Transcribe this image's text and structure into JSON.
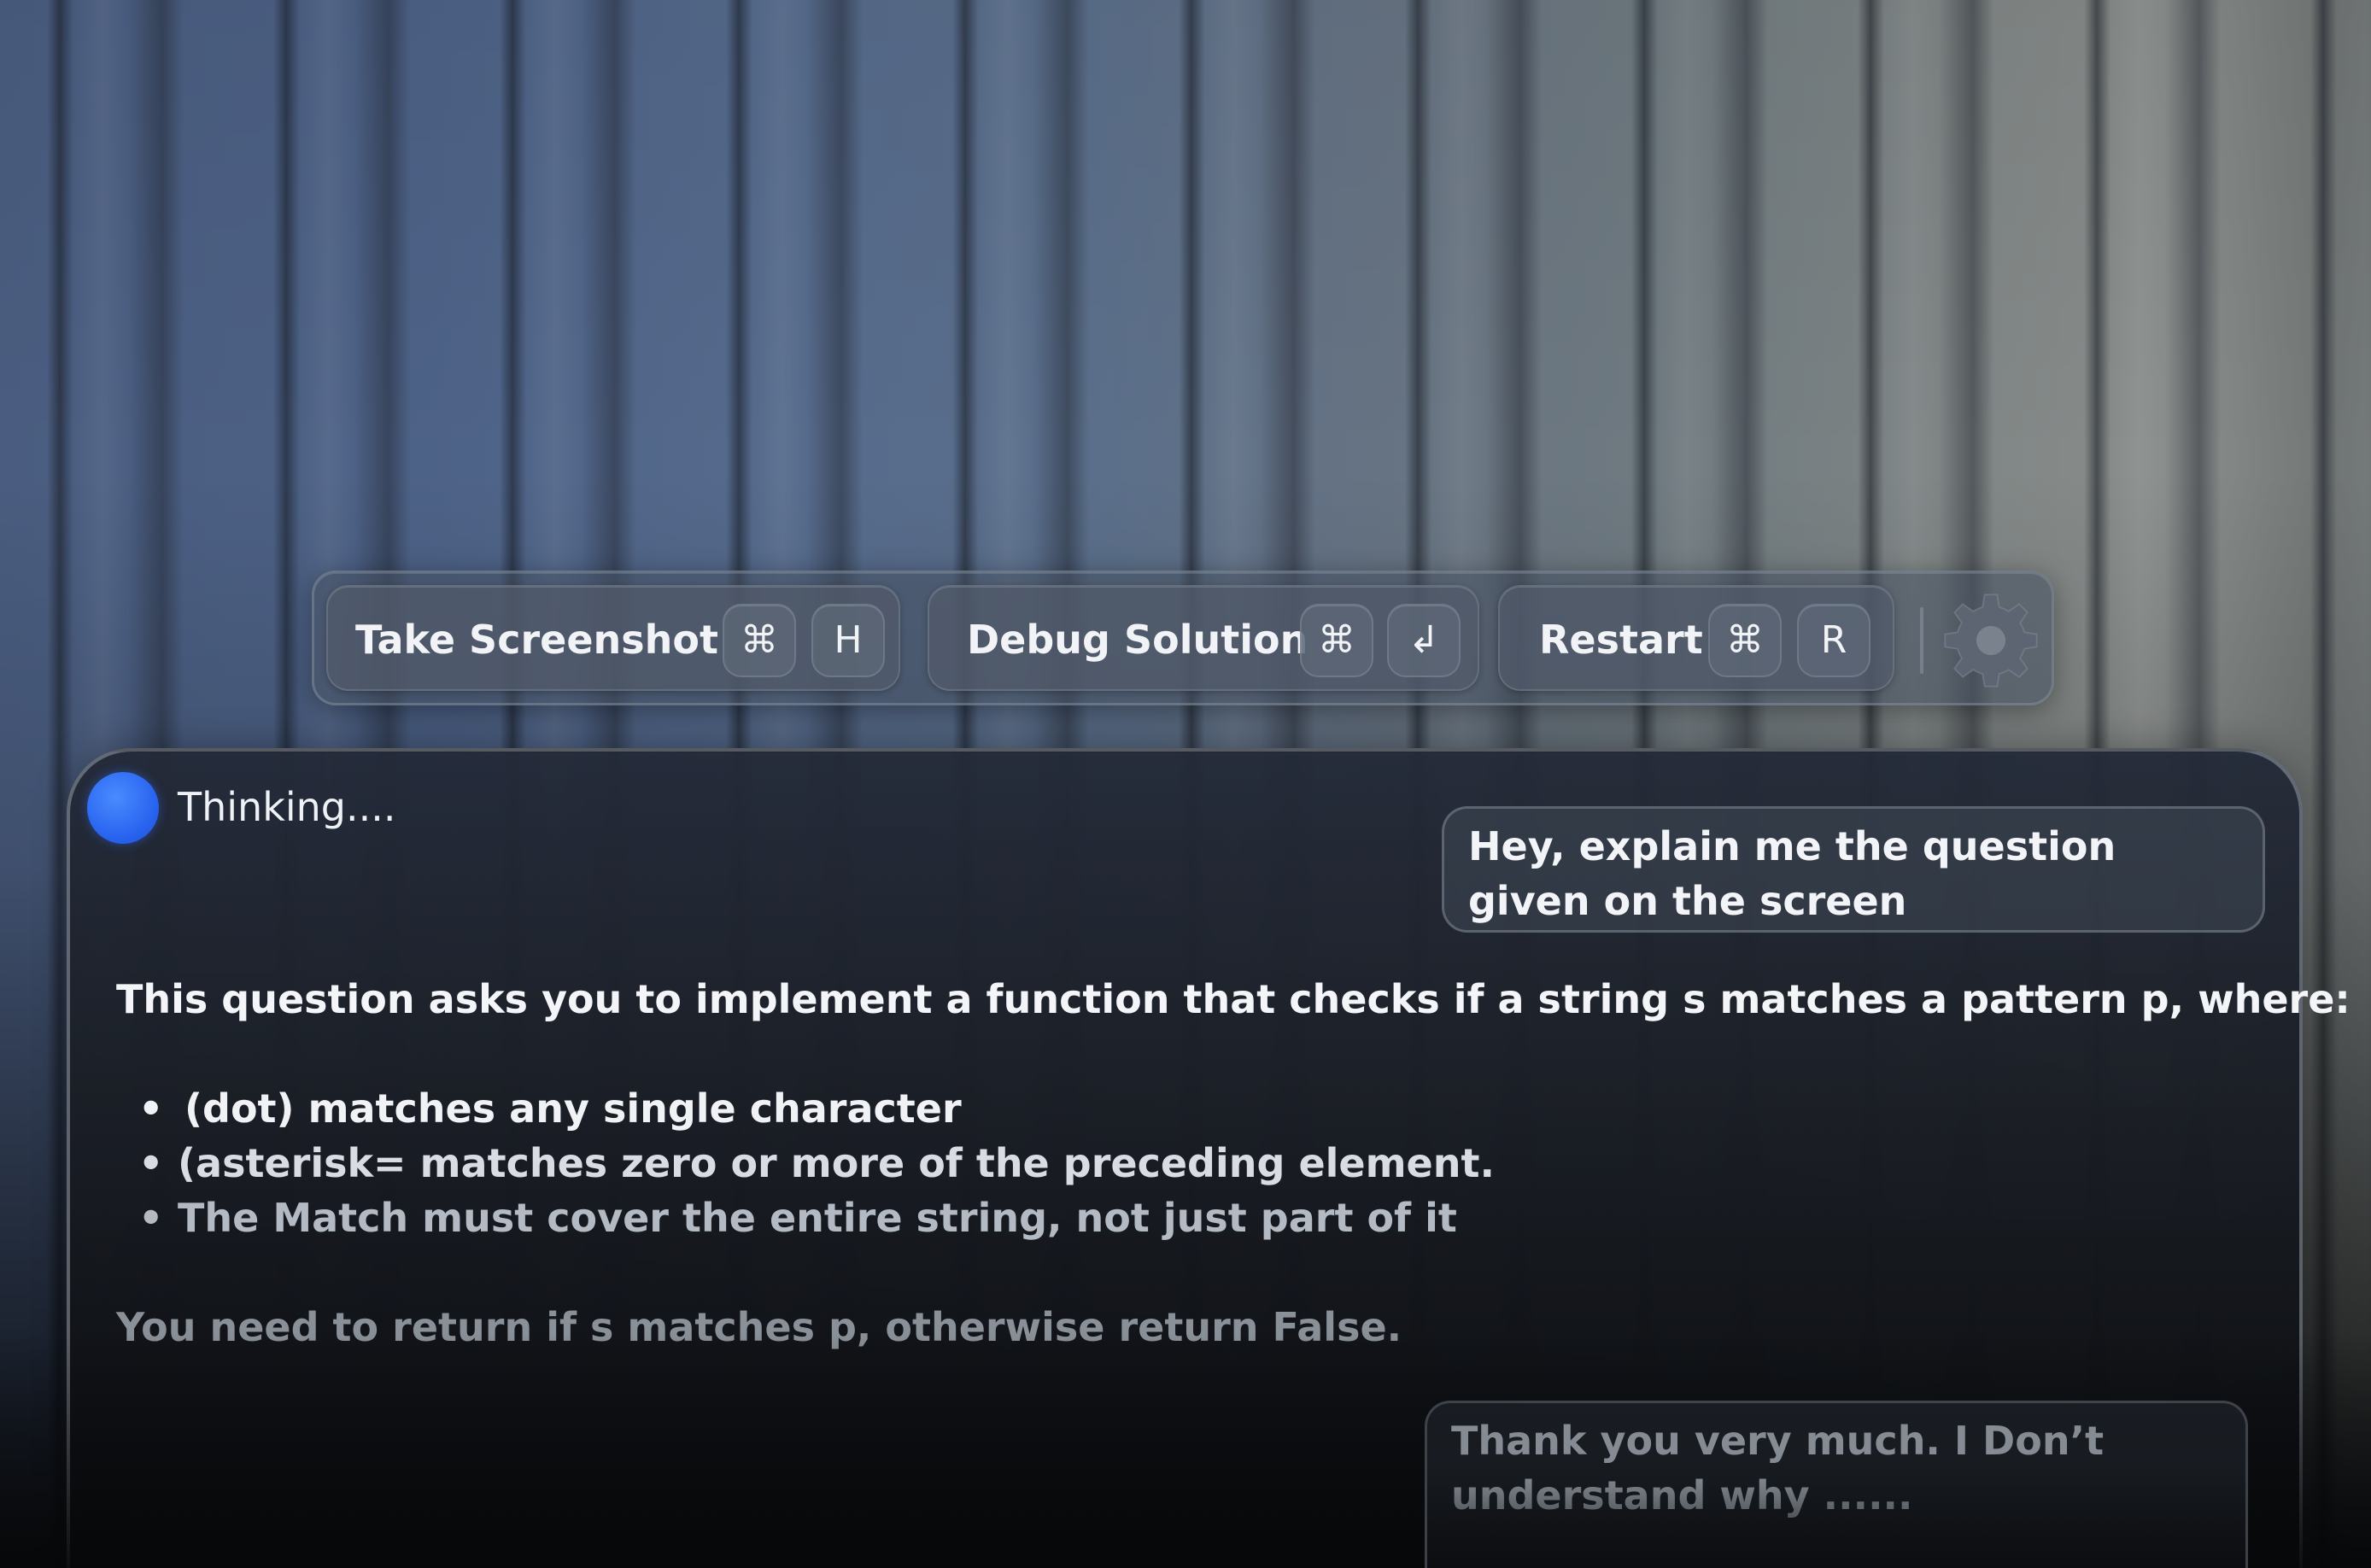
{
  "toolbar": {
    "screenshot": {
      "label": "Take Screenshot",
      "keys": [
        "⌘",
        "H"
      ]
    },
    "debug": {
      "label": "Debug Solution",
      "keys": [
        "⌘",
        "↲"
      ]
    },
    "restart": {
      "label": "Restart",
      "keys": [
        "⌘",
        "R"
      ]
    },
    "settings_icon": "gear-icon"
  },
  "status": {
    "label": "Thinking....",
    "indicator_color": "#2a66f0"
  },
  "chat": {
    "user_message_1": "Hey, explain me the question given on the screen",
    "assistant_intro": "This question asks you to implement a function that checks if a string s matches a pattern p, where:",
    "bullet_char": "•",
    "bullets": [
      "(dot) matches any single character",
      "(asterisk= matches zero or more of the preceding element.",
      "The Match must cover the entire string, not just part of it"
    ],
    "assistant_outro": "You need to return if s matches p, otherwise return False.",
    "user_message_2": "Thank you very much. I Don’t understand why ......"
  }
}
